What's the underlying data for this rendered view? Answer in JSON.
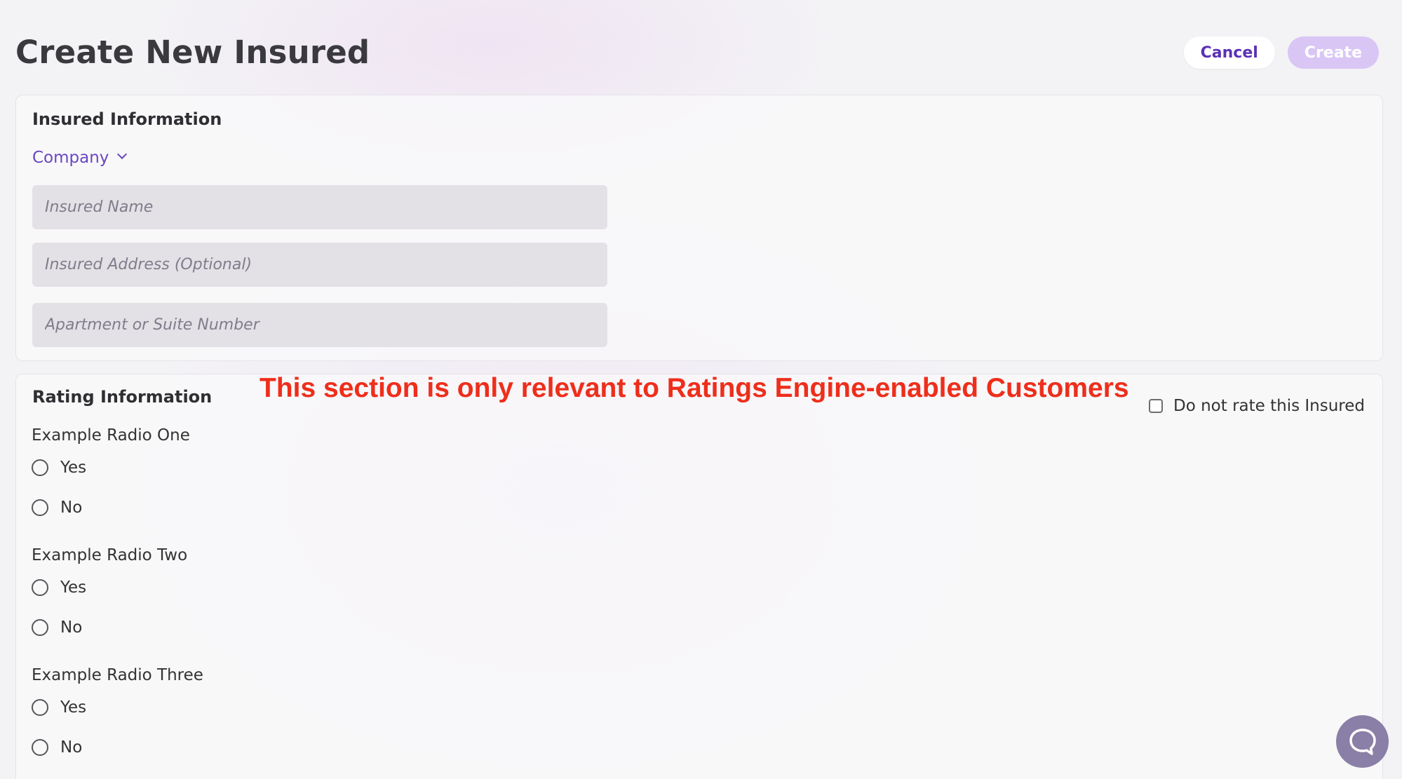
{
  "header": {
    "title": "Create New Insured",
    "cancel_label": "Cancel",
    "create_label": "Create"
  },
  "insured_info": {
    "title": "Insured Information",
    "entity_type": "Company",
    "name_placeholder": "Insured Name",
    "address_placeholder": "Insured Address (Optional)",
    "suite_placeholder": "Apartment or Suite Number"
  },
  "rating_info": {
    "title": "Rating Information",
    "annotation": "This section is only relevant to Ratings Engine-enabled Customers",
    "no_rate_label": "Do not rate this Insured",
    "questions": [
      {
        "label": "Example Radio One",
        "options": [
          "Yes",
          "No"
        ]
      },
      {
        "label": "Example Radio Two",
        "options": [
          "Yes",
          "No"
        ]
      },
      {
        "label": "Example Radio Three",
        "options": [
          "Yes",
          "No"
        ]
      }
    ]
  },
  "colors": {
    "accent": "#6b46c1",
    "create_disabled": "#d9c6f5",
    "annotation": "#ee2e1b",
    "chat": "#8a7fa6"
  },
  "icons": {
    "chat": "chat-bubble-icon",
    "dropdown": "chevron-down-icon"
  }
}
